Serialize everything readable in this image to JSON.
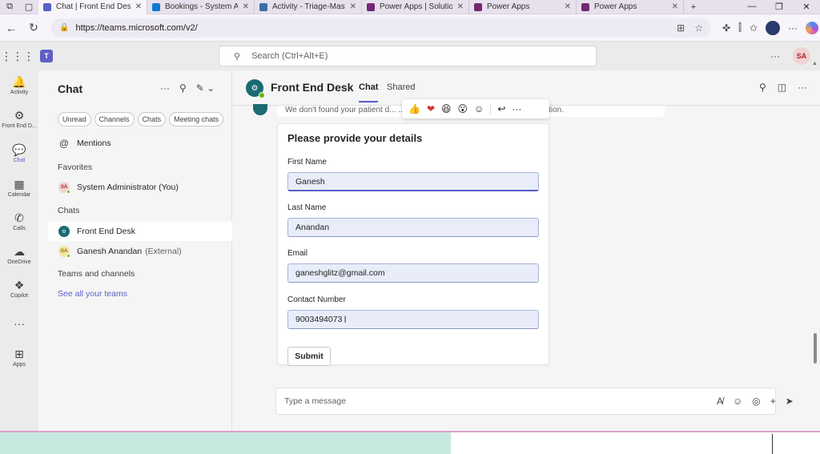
{
  "browser": {
    "tabs": [
      {
        "label": "Chat | Front End Desk",
        "active": true,
        "color": "#5b5fc7"
      },
      {
        "label": "Bookings - System Ad",
        "active": false,
        "color": "#0f78d4"
      },
      {
        "label": "Activity - Triage-Mast",
        "active": false,
        "color": "#3a6ea8"
      },
      {
        "label": "Power Apps | Solution",
        "active": false,
        "color": "#742774"
      },
      {
        "label": "Power Apps",
        "active": false,
        "color": "#742774"
      },
      {
        "label": "Power Apps",
        "active": false,
        "color": "#742774"
      }
    ],
    "new_tab": "+",
    "url": "https://teams.microsoft.com/v2/"
  },
  "teams_header": {
    "search_placeholder": "Search (Ctrl+Alt+E)",
    "more": "···",
    "user_initials": "SA"
  },
  "rail": [
    {
      "label": "Activity",
      "icon": "bell-icon",
      "glyph": "🔔"
    },
    {
      "label": "Front End D...",
      "icon": "bot-icon",
      "glyph": "⚙"
    },
    {
      "label": "Chat",
      "icon": "chat-icon",
      "glyph": "💬",
      "active": true
    },
    {
      "label": "Calendar",
      "icon": "calendar-icon",
      "glyph": "▦"
    },
    {
      "label": "Calls",
      "icon": "phone-icon",
      "glyph": "✆"
    },
    {
      "label": "OneDrive",
      "icon": "cloud-icon",
      "glyph": "☁"
    },
    {
      "label": "Copilot",
      "icon": "copilot-icon",
      "glyph": "❖"
    },
    {
      "label": "",
      "icon": "more-icon",
      "glyph": "···"
    },
    {
      "label": "Apps",
      "icon": "apps-icon",
      "glyph": "⊞"
    }
  ],
  "chatlist": {
    "title": "Chat",
    "filters": [
      "Unread",
      "Channels",
      "Chats",
      "Meeting chats"
    ],
    "mentions": "Mentions",
    "favorites_label": "Favorites",
    "favorite": {
      "name": "System Administrator (You)",
      "initials": "SA"
    },
    "chats_label": "Chats",
    "chats": [
      {
        "name": "Front End Desk",
        "external": "",
        "initials": ""
      },
      {
        "name": "Ganesh Anandan",
        "external": "(External)",
        "initials": "GA"
      }
    ],
    "teams_label": "Teams and channels",
    "see_all": "See all your teams"
  },
  "chat": {
    "title": "Front End Desk",
    "tabs": [
      "Chat",
      "Shared"
    ],
    "previous_message": "We don't found your patient d... ... ... ... ... ... ... ... ...nit your patient information.",
    "reactions": [
      "👍",
      "❤",
      "😆",
      "😮",
      "☺"
    ],
    "card": {
      "title": "Please provide your details",
      "fields": [
        {
          "label": "First Name",
          "value": "Ganesh"
        },
        {
          "label": "Last Name",
          "value": "Anandan"
        },
        {
          "label": "Email",
          "value": "ganeshglitz@gmail.com"
        },
        {
          "label": "Contact Number",
          "value": "9003494073"
        }
      ],
      "submit": "Submit"
    },
    "compose_placeholder": "Type a message"
  }
}
